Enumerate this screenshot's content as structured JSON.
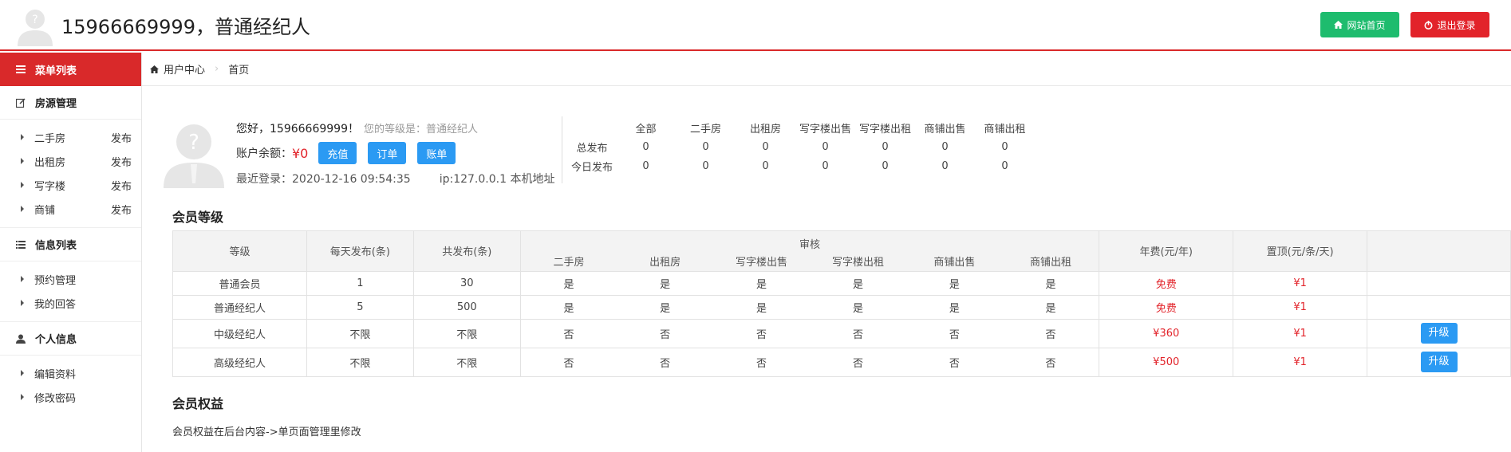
{
  "header": {
    "title": "15966669999，普通经纪人",
    "home_label": "网站首页",
    "logout_label": "退出登录"
  },
  "sidebar": {
    "menu_title": "菜单列表",
    "groups": [
      {
        "title": "房源管理",
        "items": [
          {
            "label": "二手房",
            "action": "发布"
          },
          {
            "label": "出租房",
            "action": "发布"
          },
          {
            "label": "写字楼",
            "action": "发布"
          },
          {
            "label": "商铺",
            "action": "发布"
          }
        ]
      },
      {
        "title": "信息列表",
        "items": [
          {
            "label": "预约管理"
          },
          {
            "label": "我的回答"
          }
        ]
      },
      {
        "title": "个人信息",
        "items": [
          {
            "label": "编辑资料"
          },
          {
            "label": "修改密码"
          }
        ]
      }
    ]
  },
  "breadcrumb": {
    "root": "用户中心",
    "current": "首页"
  },
  "user": {
    "greeting": "您好，15966669999！",
    "level_text": "您的等级是：普通经纪人",
    "balance_label": "账户余额：",
    "balance_value": "¥0",
    "btn_recharge": "充值",
    "btn_orders": "订单",
    "btn_bill": "账单",
    "last_login": "最近登录：2020-12-16 09:54:35",
    "ip": "ip:127.0.0.1 本机地址"
  },
  "stats": {
    "columns": [
      "全部",
      "二手房",
      "出租房",
      "写字楼出售",
      "写字楼出租",
      "商铺出售",
      "商铺出租"
    ],
    "rows": [
      {
        "label": "总发布",
        "values": [
          "0",
          "0",
          "0",
          "0",
          "0",
          "0",
          "0"
        ]
      },
      {
        "label": "今日发布",
        "values": [
          "0",
          "0",
          "0",
          "0",
          "0",
          "0",
          "0"
        ]
      }
    ]
  },
  "levels_section": {
    "title": "会员等级",
    "headers": {
      "level": "等级",
      "daily": "每天发布(条)",
      "total": "共发布(条)",
      "audit": "审核",
      "audit_cols": [
        "二手房",
        "出租房",
        "写字楼出售",
        "写字楼出租",
        "商铺出售",
        "商铺出租"
      ],
      "annual_fee": "年费(元/年)",
      "top_fee": "置顶(元/条/天)"
    },
    "rows": [
      {
        "name": "普通会员",
        "daily": "1",
        "total": "30",
        "audit": [
          "是",
          "是",
          "是",
          "是",
          "是",
          "是"
        ],
        "fee": "免费",
        "top": "¥1",
        "upgrade": ""
      },
      {
        "name": "普通经纪人",
        "daily": "5",
        "total": "500",
        "audit": [
          "是",
          "是",
          "是",
          "是",
          "是",
          "是"
        ],
        "fee": "免费",
        "top": "¥1",
        "upgrade": ""
      },
      {
        "name": "中级经纪人",
        "daily": "不限",
        "total": "不限",
        "audit": [
          "否",
          "否",
          "否",
          "否",
          "否",
          "否"
        ],
        "fee": "¥360",
        "top": "¥1",
        "upgrade": "升级"
      },
      {
        "name": "高级经纪人",
        "daily": "不限",
        "total": "不限",
        "audit": [
          "否",
          "否",
          "否",
          "否",
          "否",
          "否"
        ],
        "fee": "¥500",
        "top": "¥1",
        "upgrade": "升级"
      }
    ]
  },
  "rights_section": {
    "title": "会员权益",
    "note": "会员权益在后台内容->单页面管理里修改"
  },
  "colors": {
    "accent_red": "#d9292a",
    "green": "#1ebc6e",
    "blue": "#2b9af3"
  }
}
